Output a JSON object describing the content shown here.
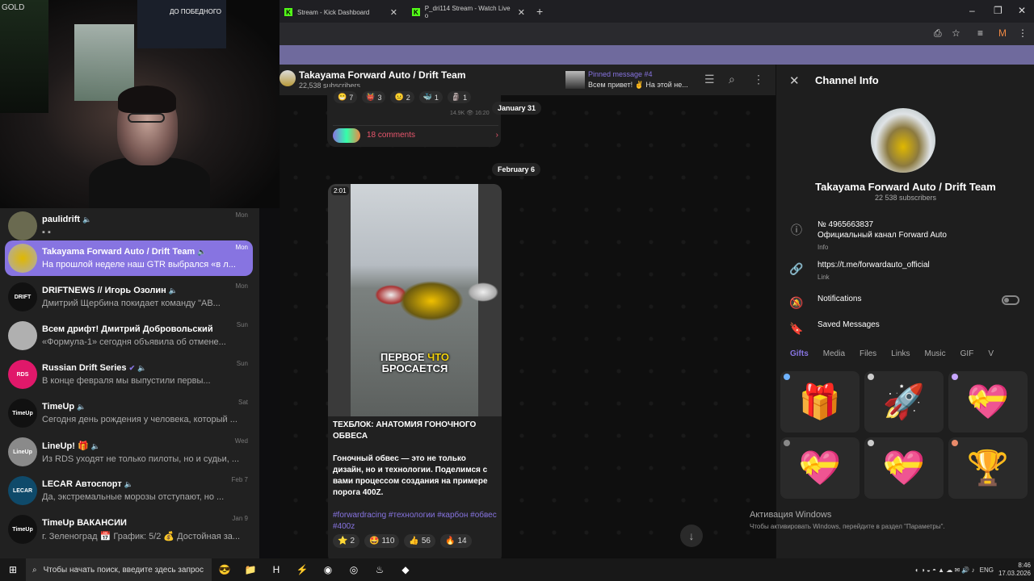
{
  "webcam": {
    "sign_gold": "GOLD",
    "sign_board": "ДО ПОБЕДНОГО"
  },
  "browser": {
    "tabs": [
      {
        "label": "Stream - Kick Dashboard"
      },
      {
        "label": "P_dri114 Stream - Watch Live o"
      }
    ]
  },
  "chats": [
    {
      "name": "paulidrift",
      "preview": "",
      "time": "Mon",
      "avatar_color": "#6a6a50"
    },
    {
      "name": "Takayama Forward Auto / Drift Team",
      "preview": "На прошлой неделе наш GTR выбрался «в л...",
      "time": "Mon",
      "avatar_color": "#c9a23a"
    },
    {
      "name": "DRIFTNEWS // Игорь Озолин",
      "preview": "Дмитрий Щербина покидает команду \"AB...",
      "time": "Mon",
      "avatar_color": "#111111",
      "avatar_text": "DRIFT"
    },
    {
      "name": "Всем дрифт! Дмитрий Добровольский",
      "preview": "«Формула-1» сегодня объявила об отмене...",
      "time": "Sun",
      "avatar_color": "#b0b0b0"
    },
    {
      "name": "Russian Drift Series",
      "preview": "В конце февраля мы выпустили первы...",
      "time": "Sun",
      "avatar_color": "#e0186a",
      "avatar_text": "RDS"
    },
    {
      "name": "TimeUp",
      "preview": "Сегодня день рождения у человека, который ...",
      "time": "Sat",
      "avatar_color": "#111111",
      "avatar_text": "TimeUp"
    },
    {
      "name": "LineUp!",
      "preview": "Из RDS уходят не только пилоты, но и судьи, ...",
      "time": "Wed",
      "avatar_color": "#8a8a8a",
      "avatar_text": "LineUp"
    },
    {
      "name": "LECAR Автоспорт",
      "preview": "Да, экстремальные морозы отступают, но ...",
      "time": "Feb 7",
      "avatar_color": "#0f4a6a",
      "avatar_text": "LECAR"
    },
    {
      "name": "TimeUp ВАКАНСИИ",
      "preview": "г. Зеленоград 📅 График: 5/2 💰 Достойная за...",
      "time": "Jan 9",
      "avatar_color": "#111111",
      "avatar_text": "TimeUp"
    }
  ],
  "channel": {
    "title": "Takayama Forward Auto / Drift Team",
    "subscribers": "22,538 subscribers",
    "pinned_title": "Pinned message #4",
    "pinned_preview": "Всем привет! ✌ На этой не..."
  },
  "top_message": {
    "reactions": [
      {
        "emoji": "😁",
        "count": "7"
      },
      {
        "emoji": "👹",
        "count": "3"
      },
      {
        "emoji": "😐",
        "count": "2"
      },
      {
        "emoji": "🐳",
        "count": "1"
      },
      {
        "emoji": "🗿",
        "count": "1"
      }
    ],
    "views": "14.9K",
    "time": "16:20",
    "comments": "18 comments"
  },
  "dates": {
    "first": "January 31",
    "second": "February 6"
  },
  "post": {
    "duration": "2:01",
    "caption_line1_a": "ПЕРВОЕ",
    "caption_line1_b": "ЧТО",
    "caption_line2": "БРОСАЕТСЯ",
    "title": "ТЕХБЛОК: АНАТОМИЯ ГОНОЧНОГО ОБВЕСА",
    "body": "Гоночный обвес — это не только дизайн, но и технологии. Поделимся с вами процессом создания на примере порога 400Z.",
    "tags": "#forwardracing #технологии #карбон #обвес #400z",
    "reactions": [
      {
        "emoji": "⭐",
        "count": "2"
      },
      {
        "emoji": "🤩",
        "count": "110"
      },
      {
        "emoji": "👍",
        "count": "56"
      },
      {
        "emoji": "🔥",
        "count": "14"
      }
    ]
  },
  "panel": {
    "title": "Channel Info",
    "name": "Takayama Forward Auto / Drift Team",
    "subscribers": "22 538 subscribers",
    "info_number": "№ 4965663837",
    "info_desc": "Официальный канал Forward Auto",
    "info_label": "Info",
    "link": "https://t.me/forwardauto_official",
    "link_label": "Link",
    "notifications": "Notifications",
    "saved": "Saved Messages",
    "tabs": [
      "Gifts",
      "Media",
      "Files",
      "Links",
      "Music",
      "GIF",
      "V"
    ],
    "gifts": [
      "🎁",
      "🚀",
      "💝",
      "💝",
      "💝",
      "🏆"
    ]
  },
  "windows": {
    "activation_title": "Активация Windows",
    "activation_sub": "Чтобы активировать Windows, перейдите в раздел \"Параметры\"."
  },
  "taskbar": {
    "search_placeholder": "Чтобы начать поиск, введите здесь запрос",
    "lang": "ENG",
    "time": "8:46",
    "date": "17.03.2026"
  }
}
